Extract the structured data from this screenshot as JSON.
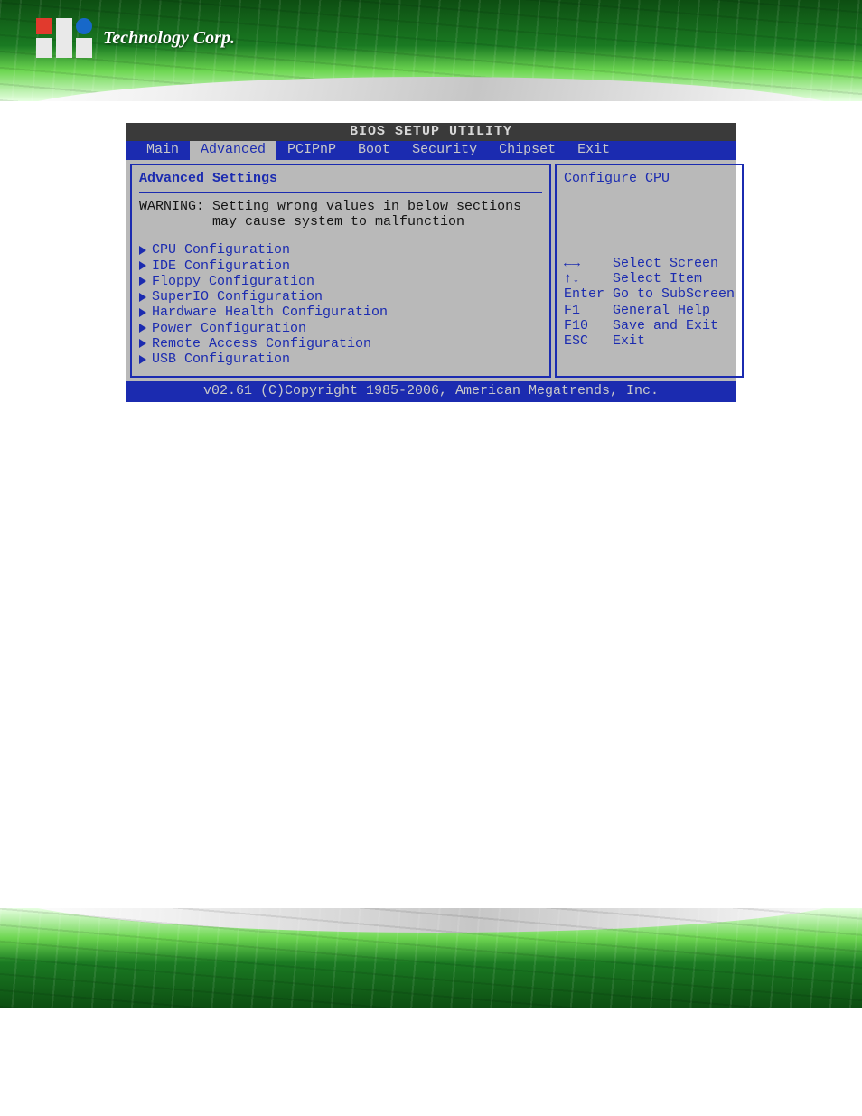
{
  "logo_text": "Technology Corp.",
  "bios": {
    "title": "BIOS SETUP UTILITY",
    "tabs": [
      "Main",
      "Advanced",
      "PCIPnP",
      "Boot",
      "Security",
      "Chipset",
      "Exit"
    ],
    "active_tab": "Advanced",
    "section_title": "Advanced Settings",
    "warning_line1": "WARNING: Setting wrong values in below sections",
    "warning_line2": "         may cause system to malfunction",
    "menu": [
      "CPU Configuration",
      "IDE Configuration",
      "Floppy Configuration",
      "SuperIO Configuration",
      "Hardware Health Configuration",
      "Power Configuration",
      "Remote Access Configuration",
      "USB Configuration"
    ],
    "help_text": "Configure CPU",
    "keys": [
      {
        "key": "←→",
        "action": "Select Screen"
      },
      {
        "key": "↑↓",
        "action": "Select Item"
      },
      {
        "key": "Enter",
        "action": "Go to SubScreen"
      },
      {
        "key": "F1",
        "action": "General Help"
      },
      {
        "key": "F10",
        "action": "Save and Exit"
      },
      {
        "key": "ESC",
        "action": "Exit"
      }
    ],
    "footer": "v02.61 (C)Copyright 1985-2006, American Megatrends, Inc."
  }
}
